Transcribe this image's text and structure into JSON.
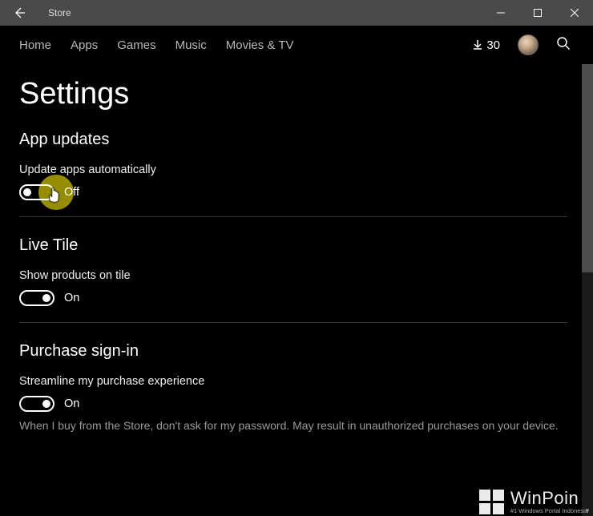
{
  "titlebar": {
    "app_title": "Store"
  },
  "nav": {
    "items": [
      "Home",
      "Apps",
      "Games",
      "Music",
      "Movies & TV"
    ],
    "download_count": "30"
  },
  "page": {
    "heading": "Settings"
  },
  "sections": {
    "app_updates": {
      "title": "App updates",
      "setting_label": "Update apps automatically",
      "toggle_state": "Off"
    },
    "live_tile": {
      "title": "Live Tile",
      "setting_label": "Show products on tile",
      "toggle_state": "On"
    },
    "purchase": {
      "title": "Purchase sign-in",
      "setting_label": "Streamline my purchase experience",
      "toggle_state": "On",
      "help_text": "When I buy from the Store, don't ask for my password. May result in unauthorized purchases on your device."
    }
  },
  "watermark": {
    "main": "WinPoin",
    "sub": "#1 Windows Portal Indonesia"
  }
}
